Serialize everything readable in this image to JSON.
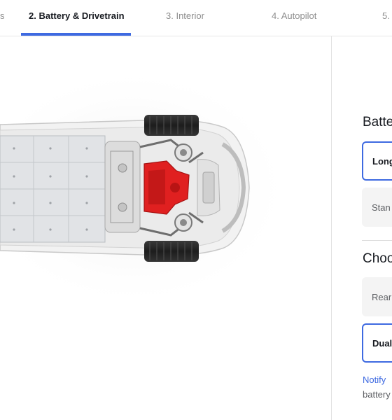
{
  "nav": {
    "steps": [
      {
        "label": "s",
        "state": "done"
      },
      {
        "label": "2. Battery & Drivetrain",
        "state": "active"
      },
      {
        "label": "3. Interior",
        "state": "upcoming"
      },
      {
        "label": "4. Autopilot",
        "state": "upcoming"
      },
      {
        "label": "5.",
        "state": "upcoming"
      }
    ],
    "accent_color": "#3e6ae1"
  },
  "vehicle_view": {
    "description_icon": "car-chassis-top-view-icon",
    "highlight_color": "#e02020"
  },
  "panel": {
    "battery": {
      "title": "Batte",
      "options": [
        {
          "label": "Long",
          "selected": true
        },
        {
          "label": "Stan",
          "selected": false
        }
      ]
    },
    "drive": {
      "title": "Choo",
      "options": [
        {
          "label": "Rear",
          "selected": false
        },
        {
          "label": "Dual",
          "selected": true
        }
      ]
    },
    "notify": {
      "link_text": "Notify",
      "trailing_text": "battery"
    }
  }
}
